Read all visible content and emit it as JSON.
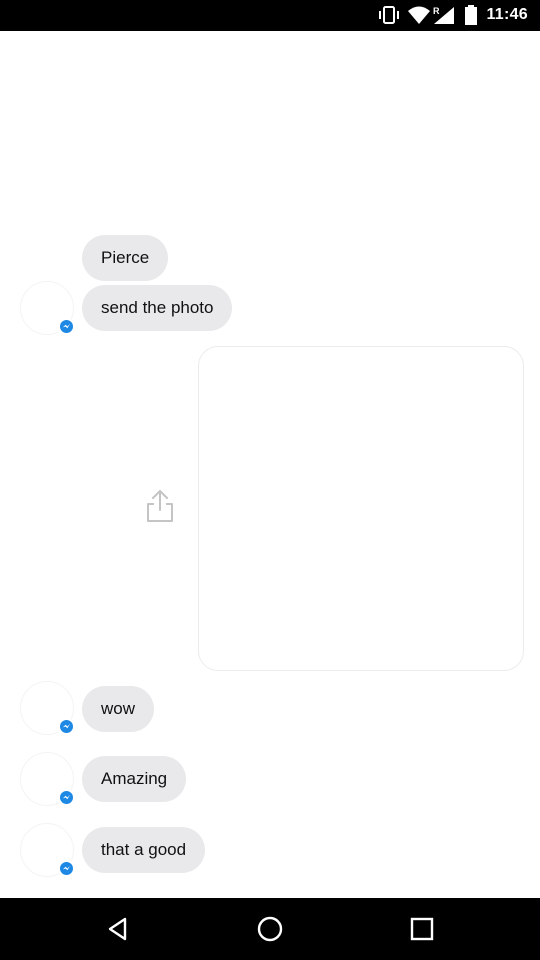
{
  "status_bar": {
    "time": "11:46",
    "network_badge": "R",
    "icons": [
      "vibrate-icon",
      "wifi-icon",
      "cell-signal-icon",
      "battery-icon"
    ]
  },
  "messages": [
    {
      "text": "Pierce",
      "sender": "contact"
    },
    {
      "text": "send the photo",
      "sender": "contact"
    },
    {
      "type": "image",
      "sender": "self"
    },
    {
      "text": "wow",
      "sender": "contact"
    },
    {
      "text": "Amazing",
      "sender": "contact"
    },
    {
      "text": "that a good",
      "sender": "contact"
    }
  ],
  "nav_bar": {
    "buttons": [
      "back-icon",
      "home-icon",
      "recents-icon"
    ]
  },
  "colors": {
    "bubble_bg": "#e9e9eb",
    "messenger_badge": "#1e88e5",
    "bars": "#000000"
  }
}
